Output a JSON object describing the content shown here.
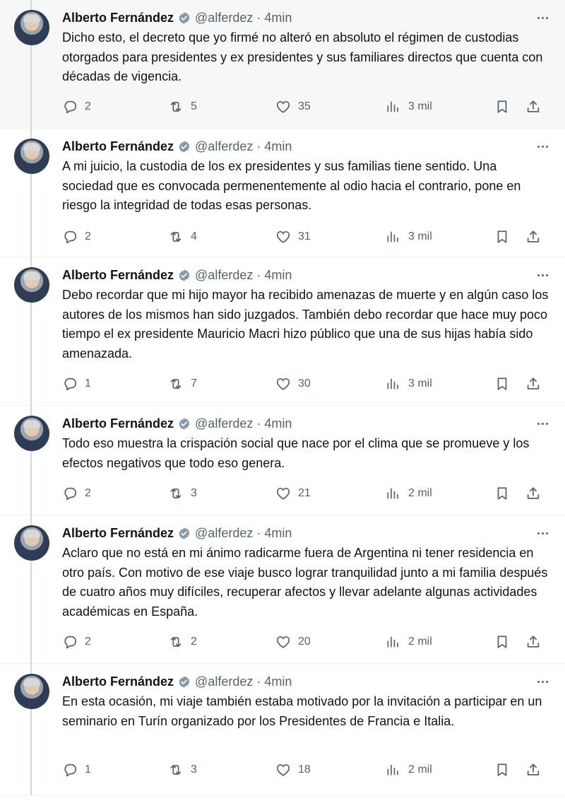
{
  "colors": {
    "text": "#0f1419",
    "secondary": "#536471",
    "verified": "#829aab",
    "thread_line": "#cfd9de"
  },
  "tweets": [
    {
      "author": "Alberto Fernández",
      "handle": "@alferdez",
      "separator": "·",
      "time": "4min",
      "text": "Dicho esto, el decreto que yo firmé no alteró en absoluto el régimen de custodias otorgados para presidentes y ex presidentes y sus familiares directos que cuenta con décadas de vigencia.",
      "replies": "2",
      "retweets": "5",
      "likes": "35",
      "views": "3 mil"
    },
    {
      "author": "Alberto Fernández",
      "handle": "@alferdez",
      "separator": "·",
      "time": "4min",
      "text": "A mi juicio, la custodia de los ex presidentes y sus familias tiene sentido. Una sociedad que es convocada permenentemente al odio hacia el contrario, pone en riesgo la integridad de todas esas personas.",
      "replies": "2",
      "retweets": "4",
      "likes": "31",
      "views": "3 mil"
    },
    {
      "author": "Alberto Fernández",
      "handle": "@alferdez",
      "separator": "·",
      "time": "4min",
      "text": "Debo recordar que mi hijo mayor ha recibido amenazas de muerte y en algún caso los autores de los mismos han sido juzgados. También debo recordar que hace muy poco tiempo el ex presidente Mauricio Macri hizo público que una de sus hijas había sido amenazada.",
      "replies": "1",
      "retweets": "7",
      "likes": "30",
      "views": "3 mil"
    },
    {
      "author": "Alberto Fernández",
      "handle": "@alferdez",
      "separator": "·",
      "time": "4min",
      "text": "Todo eso muestra la crispación social que nace por el clima que se promueve y los efectos negativos que todo eso genera.",
      "replies": "2",
      "retweets": "3",
      "likes": "21",
      "views": "2 mil"
    },
    {
      "author": "Alberto Fernández",
      "handle": "@alferdez",
      "separator": "·",
      "time": "4min",
      "text": "Aclaro que no está en mi ánimo radicarme fuera de Argentina ni tener residencia en otro país. Con motivo de ese viaje busco lograr tranquilidad junto a mi familia después de cuatro años muy difíciles, recuperar afectos y llevar adelante algunas actividades académicas en España.",
      "replies": "2",
      "retweets": "2",
      "likes": "20",
      "views": "2 mil"
    },
    {
      "author": "Alberto Fernández",
      "handle": "@alferdez",
      "separator": "·",
      "time": "4min",
      "text": "En esta ocasión, mi viaje también estaba motivado por la invitación a participar en un seminario en Turín organizado por los Presidentes de Francia e Italia.",
      "replies": "1",
      "retweets": "3",
      "likes": "18",
      "views": "2 mil"
    }
  ]
}
